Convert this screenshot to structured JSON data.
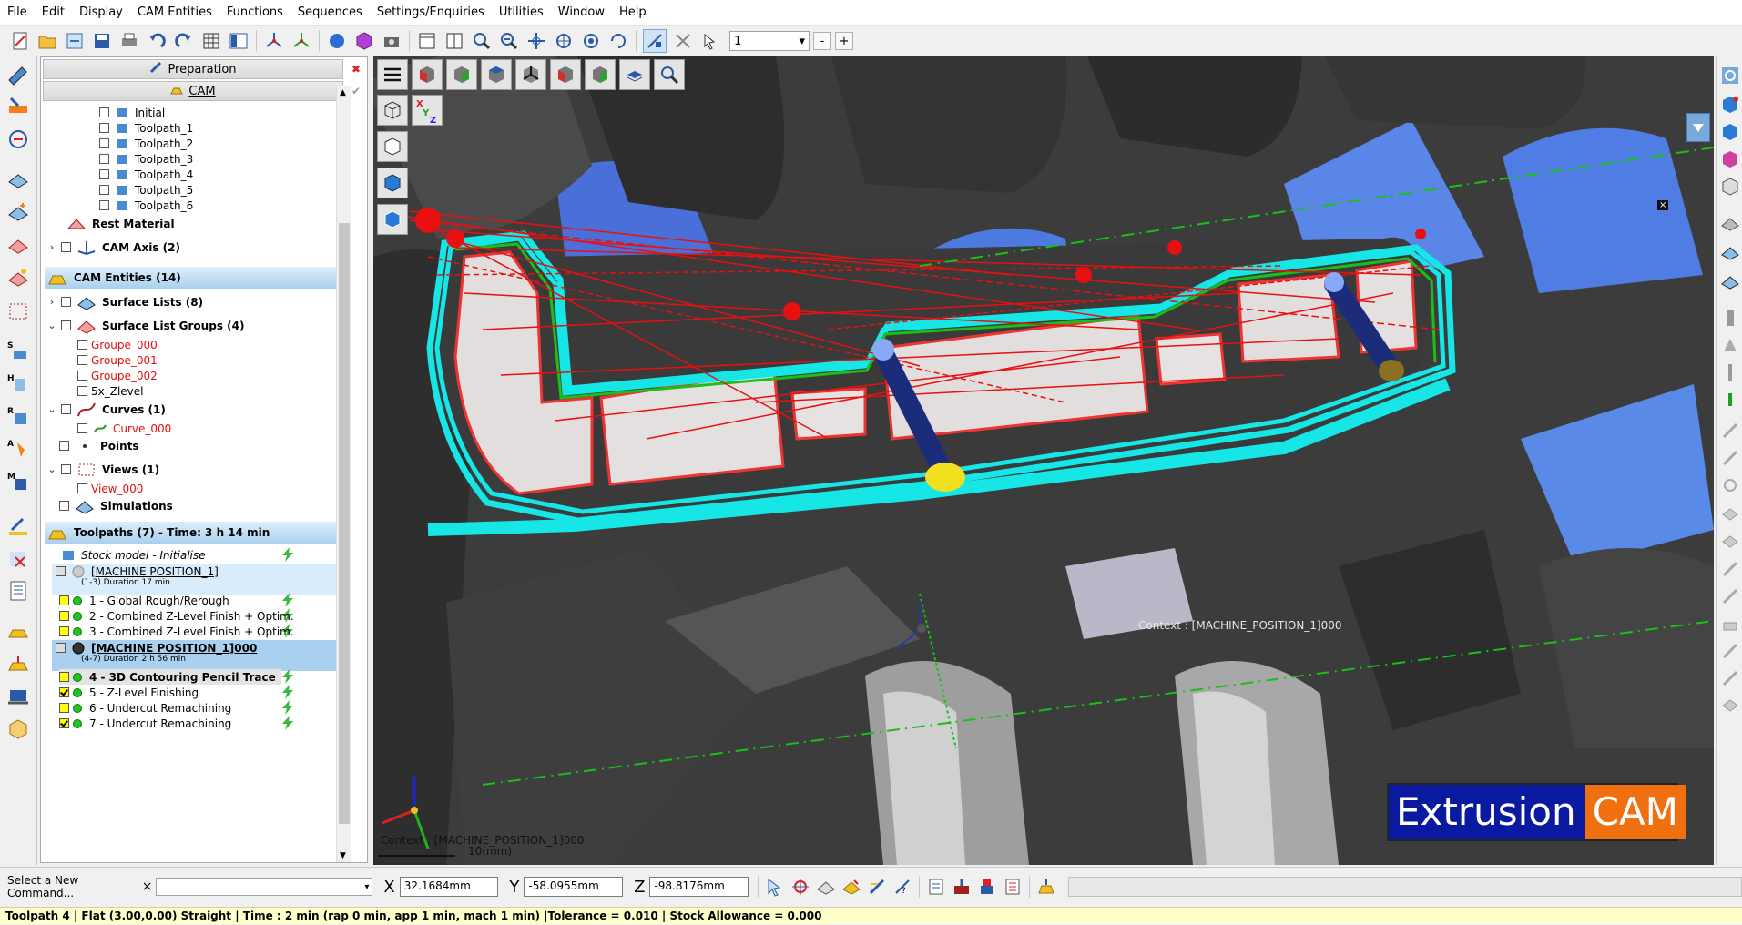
{
  "menu": [
    "File",
    "Edit",
    "Display",
    "CAM Entities",
    "Functions",
    "Sequences",
    "Settings/Enquiries",
    "Utilities",
    "Window",
    "Help"
  ],
  "toolbar": {
    "combo_value": "1",
    "minus": "-",
    "plus": "+"
  },
  "panel": {
    "tab_preparation": "Preparation",
    "tab_cam": "CAM",
    "stock_items": [
      "Initial",
      "Toolpath_1",
      "Toolpath_2",
      "Toolpath_3",
      "Toolpath_4",
      "Toolpath_5",
      "Toolpath_6"
    ],
    "rest_material": "Rest Material",
    "cam_axis": "CAM Axis (2)",
    "cam_entities": "CAM Entities (14)",
    "surface_lists": "Surface Lists (8)",
    "surface_list_groups": "Surface List Groups (4)",
    "groups": [
      "Groupe_000",
      "Groupe_001",
      "Groupe_002",
      "5x_Zlevel"
    ],
    "curves": "Curves (1)",
    "curve_item": "Curve_000",
    "points": "Points",
    "views": "Views (1)",
    "view_item": "View_000",
    "simulations": "Simulations",
    "toolpaths_header": "Toolpaths (7) - Time: 3 h 14 min",
    "stock_model": "Stock model - Initialise",
    "mp1_title": "[MACHINE POSITION_1]",
    "mp1_sub": "(1-3) Duration 17 min",
    "ops1": [
      "1 - Global Rough/Rerough",
      "2 - Combined Z-Level Finish + Optim.",
      "3 - Combined Z-Level Finish + Optim."
    ],
    "mp2_title": "[MACHINE POSITION_1]000",
    "mp2_sub": "(4-7) Duration 2 h 56 min",
    "ops2": [
      "4 - 3D Contouring Pencil Trace",
      "5 - Z-Level Finishing",
      "6 - Undercut Remachining",
      "7 - Undercut Remachining"
    ]
  },
  "viewport": {
    "context_label": "Context : [MACHINE_POSITION_1]000",
    "context_label2": "Context : [MACHINE_POSITION_1]000",
    "scale_label": "10(mm)",
    "logo_part1": "Extrusion",
    "logo_part2": "CAM"
  },
  "bottom": {
    "command_label": "Select a New Command...",
    "close_x": "×",
    "x_label": "X",
    "x_value": "32.1684mm",
    "y_label": "Y",
    "y_value": "-58.0955mm",
    "z_label": "Z",
    "z_value": "-98.8176mm"
  },
  "status": "Toolpath 4 | Flat (3.00,0.00) Straight | Time : 2 min (rap 0 min, app 1 min, mach 1 min) |Tolerance = 0.010 | Stock Allowance = 0.000",
  "colors": {
    "toolpath_cyan": "#16e6e6",
    "toolpath_red": "#e81010",
    "toolpath_green": "#18c018",
    "logo_blue": "#0a1aa0",
    "logo_orange": "#f07010",
    "status_bg": "#ffffcc"
  }
}
